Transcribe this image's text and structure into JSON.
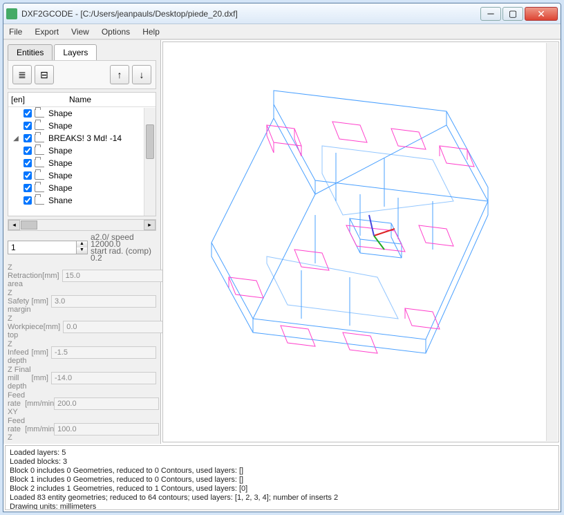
{
  "window": {
    "title": "DXF2GCODE - [C:/Users/jeanpauls/Desktop/piede_20.dxf]"
  },
  "menu": [
    "File",
    "Export",
    "View",
    "Options",
    "Help"
  ],
  "tabs": {
    "entities": "Entities",
    "layers": "Layers",
    "active": "layers"
  },
  "tree": {
    "header_col1": "[en]",
    "header_col2": "Name",
    "rows": [
      {
        "label": "Shape",
        "checked": true
      },
      {
        "label": "Shape",
        "checked": true
      },
      {
        "label": "BREAKS! 3 Md! -14",
        "checked": true,
        "parent": true
      },
      {
        "label": "Shape",
        "checked": true
      },
      {
        "label": "Shape",
        "checked": true
      },
      {
        "label": "Shape",
        "checked": true
      },
      {
        "label": "Shape",
        "checked": true
      },
      {
        "label": "Shane",
        "checked": true
      }
    ]
  },
  "spinner": {
    "value": "1",
    "info1": "a2.0/ speed 12000.0",
    "info2": "start rad. (comp) 0.2"
  },
  "params": [
    {
      "label": "Z Retraction area",
      "unit": "[mm]",
      "value": "15.0"
    },
    {
      "label": "Z Safety margin",
      "unit": "[mm]",
      "value": "3.0"
    },
    {
      "label": "Z Workpiece top",
      "unit": "[mm]",
      "value": "0.0"
    },
    {
      "label": "Z Infeed depth",
      "unit": "[mm]",
      "value": "-1.5"
    },
    {
      "label": "Z Final mill depth",
      "unit": "[mm]",
      "value": "-14.0"
    },
    {
      "label": "Feed rate XY",
      "unit": "[mm/min]",
      "value": "200.0"
    },
    {
      "label": "Feed rate Z",
      "unit": "[mm/min]",
      "value": "100.0"
    }
  ],
  "status": [
    "Loaded layers: 5",
    "Loaded blocks: 3",
    "Block 0 includes 0 Geometries, reduced to 0 Contours, used layers: []",
    "Block 1 includes 0 Geometries, reduced to 0 Contours, used layers: []",
    "Block 2 includes 1 Geometries, reduced to 1 Contours, used layers: [0]",
    "Loaded 83 entity geometries; reduced to 64 contours; used layers: [1, 2, 3, 4]; number of inserts 2",
    "Drawing units: millimeters"
  ]
}
